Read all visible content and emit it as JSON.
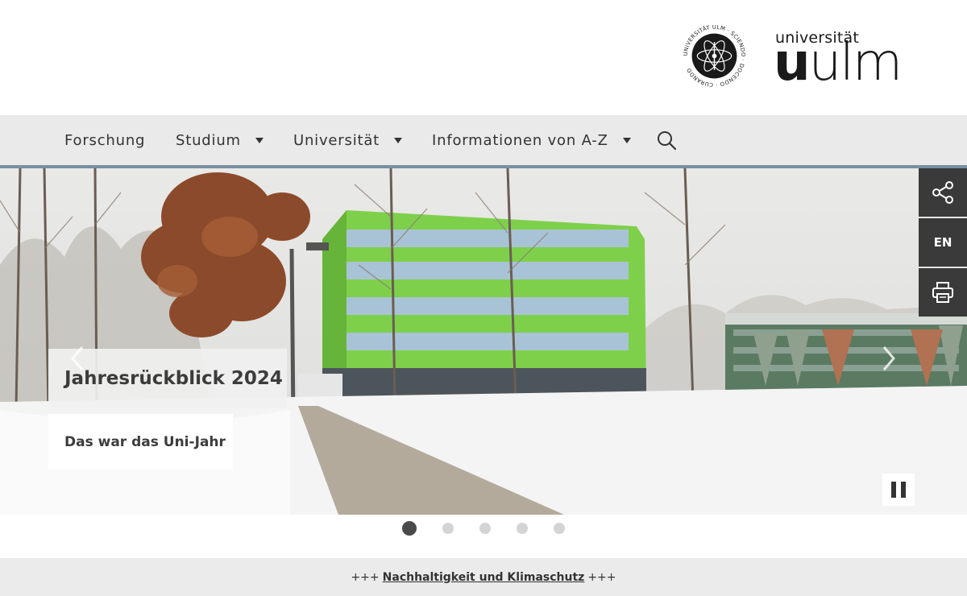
{
  "header": {
    "logo_top": "universität",
    "logo_bold": "u",
    "logo_light": "ulm",
    "seal_text": "UNIVERSITÄT ULM · SCIENDO · DOCENDO · CURANDO"
  },
  "nav": {
    "items": [
      {
        "label": "Forschung",
        "has_dropdown": false
      },
      {
        "label": "Studium",
        "has_dropdown": true
      },
      {
        "label": "Universität",
        "has_dropdown": true
      },
      {
        "label": "Informationen von A-Z",
        "has_dropdown": true
      }
    ],
    "search_icon": "search-icon",
    "accent_line": "#7a8fa1"
  },
  "hero": {
    "title": "Jahresrückblick 2024",
    "subtitle": "Das war das Uni-Jahr",
    "prev_icon": "chevron-left-icon",
    "next_icon": "chevron-right-icon",
    "pause_icon": "pause-icon",
    "building_color": "#7ed04b"
  },
  "side_tools": {
    "share_icon": "share-icon",
    "language": "EN",
    "print_icon": "printer-icon"
  },
  "slider": {
    "count": 5,
    "active_index": 0
  },
  "ticker": {
    "prefix": "+++",
    "link": "Nachhaltigkeit und Klimaschutz",
    "suffix": "+++"
  }
}
